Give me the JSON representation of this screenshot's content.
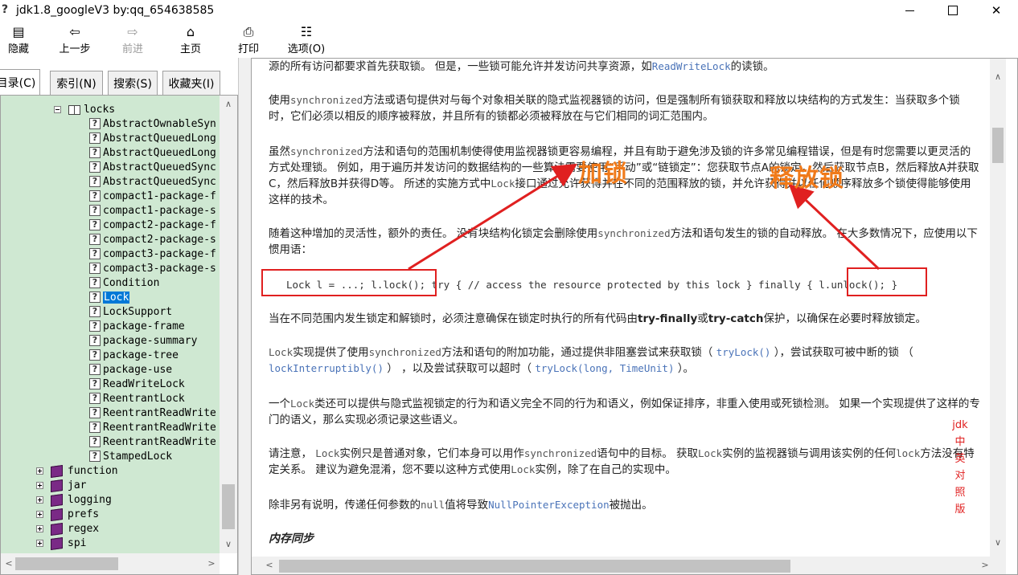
{
  "window": {
    "title": "jdk1.8_googleV3 by:qq_654638585"
  },
  "toolbar": {
    "hide": "隐藏",
    "back": "上一步",
    "forward": "前进",
    "home": "主页",
    "print": "打印",
    "options": "选项(O)"
  },
  "tabs": {
    "contents": "目录(C)",
    "index": "索引(N)",
    "search": "搜索(S)",
    "favorites": "收藏夹(I)"
  },
  "tree": {
    "root": "locks",
    "children": [
      "AbstractOwnableSyn",
      "AbstractQueuedLong",
      "AbstractQueuedLong",
      "AbstractQueuedSync",
      "AbstractQueuedSync",
      "compact1-package-f",
      "compact1-package-s",
      "compact2-package-f",
      "compact2-package-s",
      "compact3-package-f",
      "compact3-package-s",
      "Condition",
      "Lock",
      "LockSupport",
      "package-frame",
      "package-summary",
      "package-tree",
      "package-use",
      "ReadWriteLock",
      "ReentrantLock",
      "ReentrantReadWrite",
      "ReentrantReadWrite",
      "ReentrantReadWrite",
      "StampedLock"
    ],
    "siblings": [
      "function",
      "jar",
      "logging",
      "prefs",
      "regex",
      "spi"
    ]
  },
  "content": {
    "p0a": "源的所有访问都要求首先获取锁。 但是，一些锁可能允许并发访问共享资源，如",
    "p0link": "ReadWriteLock",
    "p0b": "的读锁。",
    "p1a": "使用",
    "p1mono": "synchronized",
    "p1b": "方法或语句提供对与每个对象相关联的隐式监视器锁的访问，但是强制所有锁获取和释放以块结构的方式发生：当获取多个锁时，它们必须以相反的顺序被释放，并且所有的锁都必须被释放在与它们相同的词汇范围内。",
    "p2a": "虽然",
    "p2mono": "synchronized",
    "p2b": "方法和语句的范围机制使得使用监视器锁更容易编程，并且有助于避免涉及锁的许多常见编程错误，但是有时您需要以更灵活的方式处理锁。 例如，用于遍历并发访问的数据结构的一些算法需要使用“手动”或“链锁定”：您获取节点A的锁定，然后获取节点B，然后释放A并获取C，然后释放B并获得D等。 所述的实施方式中",
    "p2mono2": "Lock",
    "p2c": "接口通过允许获得并在不同的范围释放的锁，并允许获得并以任何顺序释放多个锁使得能够使用这样的技术。",
    "p3a": "随着这种增加的灵活性，额外的责任。 没有块结构化锁定会删除使用",
    "p3mono": "synchronized",
    "p3b": "方法和语句发生的锁的自动释放。 在大多数情况下，应使用以下惯用语：",
    "code_lock": "Lock l = ...; l.lock();",
    "code_mid": " try { // access the resource protected by this lock } finally { ",
    "code_unlock": "l.unlock();",
    "code_end": " }",
    "p4a": "当在不同范围内发生锁定和解锁时，必须注意确保在锁定时执行的所有代码由",
    "p4b1": "try-finally",
    "p4mid": "或",
    "p4b2": "try-catch",
    "p4c": "保护，以确保在必要时释放锁定。",
    "p5mono": "Lock",
    "p5a": "实现提供了使用",
    "p5mono2": "synchronized",
    "p5b": "方法和语句的附加功能，通过提供非阻塞尝试来获取锁（ ",
    "p5link1": "tryLock()",
    "p5c": " ），尝试获取可被中断的锁 （ ",
    "p5link2": "lockInterruptibly()",
    "p5d": " ） ，以及尝试获取可以超时（ ",
    "p5link3": "tryLock(long, TimeUnit)",
    "p5e": " ）。",
    "p6a": "一个",
    "p6mono": "Lock",
    "p6b": "类还可以提供与隐式监视锁定的行为和语义完全不同的行为和语义，例如保证排序，非重入使用或死锁检测。 如果一个实现提供了这样的专门的语义，那么实现必须记录这些语义。",
    "p7a": "请注意， ",
    "p7mono": "Lock",
    "p7b": "实例只是普通对象，它们本身可以用作",
    "p7mono2": "synchronized",
    "p7c": "语句中的目标。 获取",
    "p7mono3": "Lock",
    "p7d": "实例的监视器锁与调用该实例的任何",
    "p7mono4": "lock",
    "p7e": "方法没有特定关系。 建议为避免混淆，您不要以这种方式使用",
    "p7mono5": "Lock",
    "p7f": "实例，除了在自己的实现中。",
    "p8a": "除非另有说明，传递任何参数的",
    "p8mono": "null",
    "p8b": "值将导致",
    "p8link": "NullPointerException",
    "p8c": "被抛出。",
    "heading": "内存同步"
  },
  "annotations": {
    "lock_label": "加锁",
    "unlock_label": "释放锁",
    "side_note": [
      "jdk",
      "中",
      "英",
      "对",
      "照",
      "版"
    ]
  },
  "colors": {
    "annotation_red": "#e02020",
    "annotation_orange": "#f07a1a",
    "tree_bg": "#cfe8d2",
    "selection": "#0078d7"
  }
}
